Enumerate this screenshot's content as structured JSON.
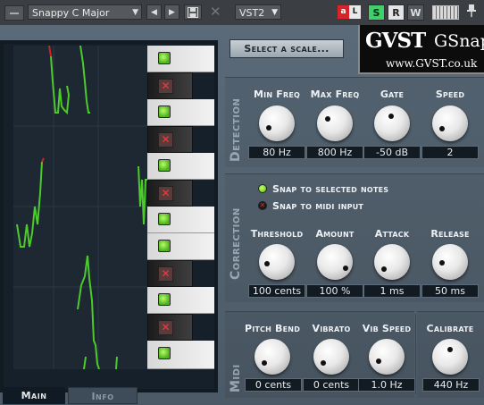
{
  "host": {
    "preset": "Snappy C Major",
    "plugin_format": "VST2",
    "record_a": "a",
    "record_b": "L",
    "s_label": "S",
    "r_label": "R",
    "w_label": "W"
  },
  "header": {
    "scale_button": "Select a scale...",
    "logo_mark": "GVST",
    "logo_name": "GSnap",
    "logo_url": "www.GVST.co.uk"
  },
  "sections": {
    "detection": "Detection",
    "correction": "Correction",
    "midi": "Midi"
  },
  "detection": [
    {
      "label": "Min Freq",
      "value": "80 Hz"
    },
    {
      "label": "Max Freq",
      "value": "800 Hz"
    },
    {
      "label": "Gate",
      "value": "-50 dB"
    },
    {
      "label": "Speed",
      "value": "2"
    }
  ],
  "correction": {
    "options": [
      {
        "label": "Snap to selected notes",
        "selected": true
      },
      {
        "label": "Snap to midi input",
        "selected": false
      }
    ],
    "knobs": [
      {
        "label": "Threshold",
        "value": "100 cents"
      },
      {
        "label": "Amount",
        "value": "100 %"
      },
      {
        "label": "Attack",
        "value": "1 ms"
      },
      {
        "label": "Release",
        "value": "50 ms"
      }
    ]
  },
  "midi": [
    {
      "label": "Pitch Bend",
      "value": "0 cents"
    },
    {
      "label": "Vibrato",
      "value": "0 cents"
    },
    {
      "label": "Vib Speed",
      "value": "1.0 Hz"
    }
  ],
  "calibrate": {
    "label": "Calibrate",
    "value": "440 Hz"
  },
  "tabs": {
    "main": "Main",
    "info": "Info"
  },
  "colors": {
    "pitch_line": "#4ccb2a",
    "pitch_off": "#d32020",
    "active_led": "#7fe23a"
  }
}
